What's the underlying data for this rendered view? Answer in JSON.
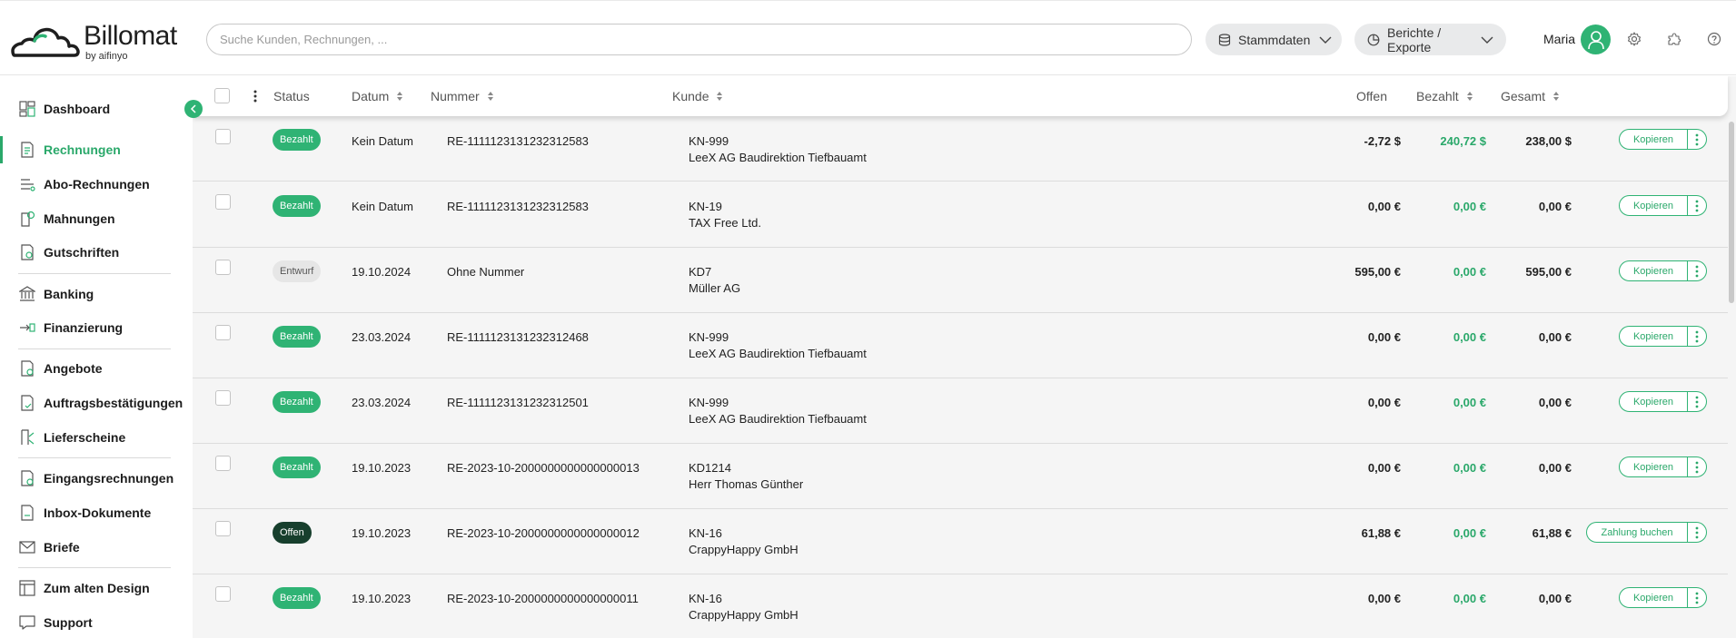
{
  "app": {
    "brand": "Billomat",
    "brand_sub": "by aifinyo",
    "accent": "#2fb374"
  },
  "header": {
    "search_placeholder": "Suche Kunden, Rechnungen, ...",
    "stammdaten_label": "Stammdaten",
    "berichte_label": "Berichte / Exporte",
    "user_name": "Maria",
    "icons": [
      "database-icon",
      "chevron-down-icon",
      "chart-pie-icon",
      "avatar",
      "gear-icon",
      "puzzle-icon",
      "help-icon"
    ]
  },
  "sidebar": {
    "items": [
      {
        "label": "Dashboard",
        "icon": "dashboard-icon"
      },
      {
        "label": "Rechnungen",
        "icon": "invoice-icon",
        "active": true
      },
      {
        "label": "Abo-Rechnungen",
        "icon": "subscription-icon"
      },
      {
        "label": "Mahnungen",
        "icon": "reminder-icon"
      },
      {
        "label": "Gutschriften",
        "icon": "credit-note-icon"
      },
      {
        "label": "Banking",
        "icon": "bank-icon"
      },
      {
        "label": "Finanzierung",
        "icon": "financing-icon"
      },
      {
        "label": "Angebote",
        "icon": "offer-icon"
      },
      {
        "label": "Auftragsbestätigungen",
        "icon": "order-confirmation-icon"
      },
      {
        "label": "Lieferscheine",
        "icon": "delivery-note-icon"
      },
      {
        "label": "Eingangsrechnungen",
        "icon": "incoming-invoice-icon"
      },
      {
        "label": "Inbox-Dokumente",
        "icon": "inbox-icon"
      },
      {
        "label": "Briefe",
        "icon": "letter-icon"
      },
      {
        "label": "Zum alten Design",
        "icon": "layout-icon"
      },
      {
        "label": "Support",
        "icon": "support-icon"
      }
    ]
  },
  "table": {
    "columns": {
      "status": "Status",
      "datum": "Datum",
      "nummer": "Nummer",
      "kunde": "Kunde",
      "offen": "Offen",
      "bezahlt": "Bezahlt",
      "gesamt": "Gesamt"
    },
    "rows": [
      {
        "status": "Bezahlt",
        "status_kind": "bezahlt",
        "datum": "Kein Datum",
        "nummer": "RE-1111123131232312583",
        "kunde_nr": "KN-999",
        "kunde_name": "LeeX AG Baudirektion Tiefbauamt",
        "offen": "-2,72 $",
        "bezahlt": "240,72 $",
        "gesamt": "238,00 $",
        "action": "Kopieren"
      },
      {
        "status": "Bezahlt",
        "status_kind": "bezahlt",
        "datum": "Kein Datum",
        "nummer": "RE-1111123131232312583",
        "kunde_nr": "KN-19",
        "kunde_name": "TAX Free Ltd.",
        "offen": "0,00 €",
        "bezahlt": "0,00 €",
        "gesamt": "0,00 €",
        "action": "Kopieren"
      },
      {
        "status": "Entwurf",
        "status_kind": "entwurf",
        "datum": "19.10.2024",
        "nummer": "Ohne Nummer",
        "kunde_nr": "KD7",
        "kunde_name": "Müller AG",
        "offen": "595,00 €",
        "bezahlt": "0,00 €",
        "gesamt": "595,00 €",
        "action": "Kopieren"
      },
      {
        "status": "Bezahlt",
        "status_kind": "bezahlt",
        "datum": "23.03.2024",
        "nummer": "RE-1111123131232312468",
        "kunde_nr": "KN-999",
        "kunde_name": "LeeX AG Baudirektion Tiefbauamt",
        "offen": "0,00 €",
        "bezahlt": "0,00 €",
        "gesamt": "0,00 €",
        "action": "Kopieren"
      },
      {
        "status": "Bezahlt",
        "status_kind": "bezahlt",
        "datum": "23.03.2024",
        "nummer": "RE-1111123131232312501",
        "kunde_nr": "KN-999",
        "kunde_name": "LeeX AG Baudirektion Tiefbauamt",
        "offen": "0,00 €",
        "bezahlt": "0,00 €",
        "gesamt": "0,00 €",
        "action": "Kopieren"
      },
      {
        "status": "Bezahlt",
        "status_kind": "bezahlt",
        "datum": "19.10.2023",
        "nummer": "RE-2023-10-2000000000000000013",
        "kunde_nr": "KD1214",
        "kunde_name": "Herr Thomas Günther",
        "offen": "0,00 €",
        "bezahlt": "0,00 €",
        "gesamt": "0,00 €",
        "action": "Kopieren"
      },
      {
        "status": "Offen",
        "status_kind": "offen",
        "datum": "19.10.2023",
        "nummer": "RE-2023-10-2000000000000000012",
        "kunde_nr": "KN-16",
        "kunde_name": "CrappyHappy GmbH",
        "offen": "61,88 €",
        "bezahlt": "0,00 €",
        "gesamt": "61,88 €",
        "action": "Zahlung buchen"
      },
      {
        "status": "Bezahlt",
        "status_kind": "bezahlt",
        "datum": "19.10.2023",
        "nummer": "RE-2023-10-2000000000000000011",
        "kunde_nr": "KN-16",
        "kunde_name": "CrappyHappy GmbH",
        "offen": "0,00 €",
        "bezahlt": "0,00 €",
        "gesamt": "0,00 €",
        "action": "Kopieren"
      }
    ]
  }
}
